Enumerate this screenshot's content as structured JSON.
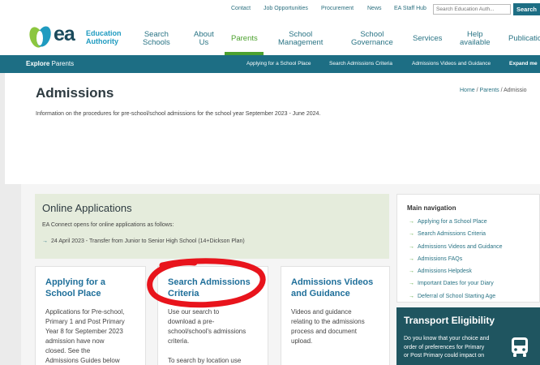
{
  "utility": {
    "links": [
      "Contact",
      "Job Opportunities",
      "Procurement",
      "News",
      "EA Staff Hub"
    ],
    "search_placeholder": "Search Education Auth...",
    "search_button": "Search"
  },
  "logo": {
    "text": "ea",
    "line1": "Education",
    "line2": "Authority"
  },
  "nav": {
    "items": [
      {
        "line1": "Search",
        "line2": "Schools"
      },
      {
        "line1": "About",
        "line2": "Us"
      },
      {
        "line1": "Parents",
        "line2": ""
      },
      {
        "line1": "School",
        "line2": "Management"
      },
      {
        "line1": "School",
        "line2": "Governance"
      },
      {
        "line1": "Services",
        "line2": ""
      },
      {
        "line1": "Help",
        "line2": "available"
      },
      {
        "line1": "Publicatio",
        "line2": ""
      }
    ]
  },
  "subbar": {
    "explore_bold": "Explore",
    "explore_rest": " Parents",
    "links": [
      "Applying for a School Place",
      "Search Admissions Criteria",
      "Admissions Videos and Guidance",
      "Expand me"
    ]
  },
  "page": {
    "title": "Admissions",
    "breadcrumb": [
      "Home",
      "Parents",
      "Admissio"
    ],
    "breadcrumb_sep": "/",
    "intro": "Information on the procedures for pre-school/school admissions for the school year September 2023 - June 2024."
  },
  "online": {
    "heading": "Online Applications",
    "text": "EA Connect opens for online applications as follows:",
    "item": "24 April 2023 - Transfer from Junior to Senior High School (14+Dickson Plan)"
  },
  "cards": [
    {
      "title_l1": "Applying for a",
      "title_l2": "School Place",
      "body": [
        "Applications for Pre-school,",
        "Primary 1 and Post Primary",
        "Year 8 for September 2023",
        "admission have now",
        "closed.  See the",
        "Admissions Guides below"
      ]
    },
    {
      "title_l1": "Search Admissions",
      "title_l2": "Criteria",
      "body": [
        "Use our search to",
        "download a pre-",
        "school/school's admissions",
        "criteria.",
        "",
        "To search by location use"
      ]
    },
    {
      "title_l1": "Admissions Videos",
      "title_l2": "and Guidance",
      "body": [
        "Videos and guidance",
        "relating to the admissions",
        "process and document",
        "upload."
      ]
    }
  ],
  "sidebar": {
    "heading": "Main navigation",
    "items": [
      "Applying for a School Place",
      "Search Admissions Criteria",
      "Admissions Videos and Guidance",
      "Admissions FAQs",
      "Admissions Helpdesk",
      "Important Dates for your Diary",
      "Deferral of School Starting Age"
    ]
  },
  "transport": {
    "heading": "Transport Eligibility",
    "lines": [
      "Do you know that your choice and",
      "order of preferences for Primary",
      "or Post Primary could impact on"
    ]
  },
  "colors": {
    "teal": "#1d6e84",
    "green": "#4da12f",
    "annotation": "#e8141c"
  }
}
